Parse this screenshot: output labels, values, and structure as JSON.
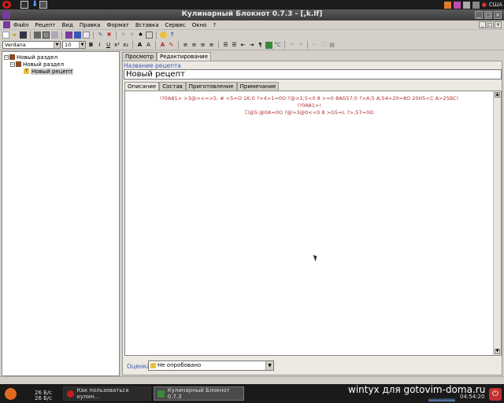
{
  "window": {
    "title": "Кулинарный Блокнот 0.7.3 - [,k.lf]"
  },
  "top_panel": {
    "locale": "США",
    "icons": [
      "opera-icon",
      "terminal-icon",
      "download-icon",
      "window-icon"
    ]
  },
  "menu": {
    "items": [
      "Файл",
      "Рецепт",
      "Вид",
      "Правка",
      "Формат",
      "Вставка",
      "Сервис",
      "Окно",
      "?"
    ]
  },
  "toolbar": {
    "font_name": "Verdana",
    "font_size": "10"
  },
  "tree": {
    "items": [
      {
        "label": "Новый раздел",
        "level": "root"
      },
      {
        "label": "Новый раздел",
        "level": "child"
      },
      {
        "label": "Новый рецепт",
        "level": "leaf"
      }
    ]
  },
  "main_tabs": [
    "Просмотр",
    "Редактирование"
  ],
  "recipe": {
    "name_label": "Название рецепта",
    "name_value": "Новый рецепт"
  },
  "inner_tabs": [
    "Описание",
    "Состав",
    "Приготовление",
    "Примечание"
  ],
  "description": {
    "lines": [
      "!?0A81> >3@><=>5. # <5=O 1K;0 ?>4>1=0O ?@>1;5<0 8 >=0 8AG57;0 ?>A;5 A;54>20=8O 20H5<C A>25BC!",
      "!?0A81>!",
      "☐@5:@0A=0O ?@>3@0<<0 8 >G5=L ?>;57=0O"
    ]
  },
  "rating": {
    "label": "Оценка",
    "value": "Не опробовано"
  },
  "taskbar": {
    "net_up": "26 Б/с",
    "net_down": "26 Б/с",
    "tasks": [
      "Как пользоваться кулин...",
      "Кулинарный Блокнот 0.7.3"
    ],
    "watermark": "wintyx для gotovim-doma.ru",
    "clock": "04:54:20"
  }
}
